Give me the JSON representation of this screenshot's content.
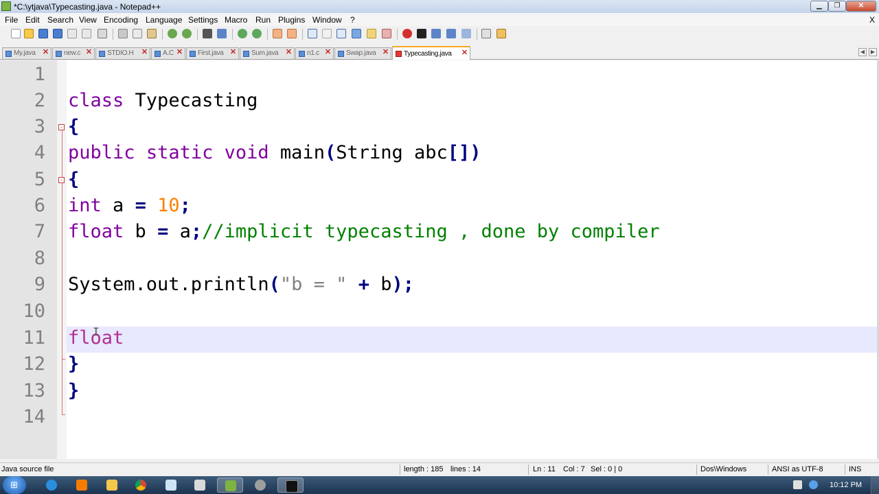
{
  "window": {
    "title": "*C:\\ytjava\\Typecasting.java - Notepad++",
    "minimize": "▁",
    "maximize": "❐",
    "close": "✕"
  },
  "menu": {
    "items": [
      "File",
      "Edit",
      "Search",
      "View",
      "Encoding",
      "Language",
      "Settings",
      "Macro",
      "Run",
      "Plugins",
      "Window",
      "?"
    ],
    "close": "X"
  },
  "tabs": [
    {
      "label": "My.java",
      "active": false
    },
    {
      "label": "new.c",
      "active": false
    },
    {
      "label": "STDIO.H",
      "active": false
    },
    {
      "label": "A.C",
      "active": false
    },
    {
      "label": "First.java",
      "active": false
    },
    {
      "label": "Sum.java",
      "active": false
    },
    {
      "label": "n1.c",
      "active": false
    },
    {
      "label": "Swap.java",
      "active": false
    },
    {
      "label": "Typecasting.java",
      "active": true
    }
  ],
  "tab_close_glyph": "✕",
  "tab_nav": {
    "left": "◀",
    "right": "▶"
  },
  "editor": {
    "line_numbers": [
      "1",
      "2",
      "3",
      "4",
      "5",
      "6",
      "7",
      "8",
      "9",
      "10",
      "11",
      "12",
      "13",
      "14"
    ],
    "current_line": 11,
    "fold_marker": "-",
    "tokens": {
      "l2": [
        "class",
        "Typecasting"
      ],
      "l3": [
        "{"
      ],
      "l4": [
        "public",
        "static",
        "void",
        "main",
        "(",
        "String abc",
        "[]",
        ")"
      ],
      "l5": [
        "{"
      ],
      "l6": [
        "int",
        " a ",
        "=",
        " ",
        "10",
        ";"
      ],
      "l7": [
        "float",
        " b ",
        "=",
        " a",
        ";",
        "//implicit typecasting , done by compiler"
      ],
      "l9": [
        "System.out.println",
        "(",
        "\"b = \"",
        " ",
        "+",
        " b",
        ")",
        ";"
      ],
      "l11": [
        "float"
      ],
      "l12": [
        "}"
      ],
      "l13": [
        "}"
      ]
    },
    "text_cursor": "I"
  },
  "status": {
    "file_type": "Java source file",
    "length": "length : 185",
    "lines": "lines : 14",
    "ln": "Ln : 11",
    "col": "Col : 7",
    "sel": "Sel : 0 | 0",
    "eol": "Dos\\Windows",
    "encoding": "ANSI as UTF-8",
    "mode": "INS"
  },
  "taskbar": {
    "start_glyph": "⊞",
    "apps": [
      "internet-explorer",
      "xampp",
      "file-explorer",
      "chrome",
      "notepad",
      "folder",
      "notepad-plus-plus",
      "app-green",
      "command-prompt"
    ],
    "clock": "10:12 PM"
  },
  "colors": {
    "keyword": "#8000a0",
    "operator": "#000080",
    "number": "#ff8000",
    "comment": "#008000",
    "string": "#808080",
    "caret_line": "#e8e8ff"
  }
}
